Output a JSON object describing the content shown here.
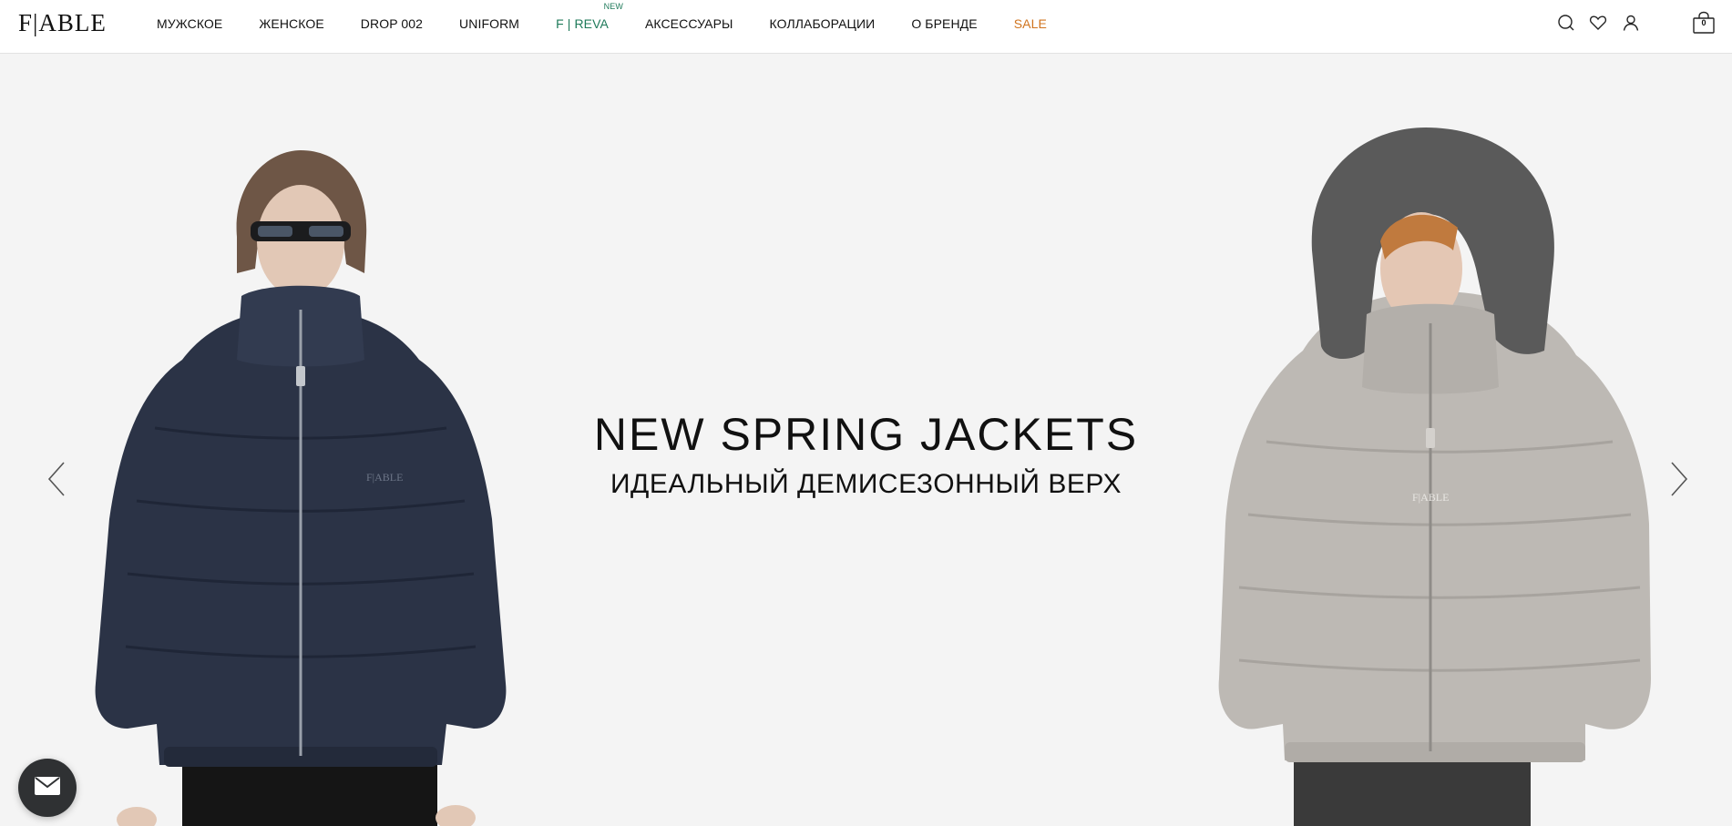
{
  "brand": {
    "logo": "F|ABLE"
  },
  "nav": {
    "items": [
      {
        "label": "МУЖСКОЕ"
      },
      {
        "label": "ЖЕНСКОЕ"
      },
      {
        "label": "DROP 002"
      },
      {
        "label": "UNIFORM"
      },
      {
        "label": "F | REVA",
        "badge": "NEW"
      },
      {
        "label": "АКСЕССУАРЫ"
      },
      {
        "label": "КОЛЛАБОРАЦИИ"
      },
      {
        "label": "О БРЕНДЕ"
      },
      {
        "label": "SALE"
      }
    ]
  },
  "header_icons": {
    "search": "search-icon",
    "wishlist": "heart-icon",
    "account": "user-icon",
    "cart": "shopping-bag-icon",
    "cart_count": "0"
  },
  "hero": {
    "title": "NEW SPRING JACKETS",
    "subtitle": "ИДЕАЛЬНЫЙ ДЕМИСЕЗОННЫЙ ВЕРХ",
    "left_jacket_logo": "F|ABLE",
    "right_jacket_logo": "F|ABLE",
    "prev_icon": "chevron-left-icon",
    "next_icon": "chevron-right-icon"
  },
  "chat": {
    "icon": "mail-icon"
  },
  "colors": {
    "accent_green": "#1f7a5a",
    "sale_orange": "#d0741f",
    "background": "#f4f4f4",
    "navy_jacket": "#2b3346",
    "grey_jacket": "#bdb9b4"
  }
}
